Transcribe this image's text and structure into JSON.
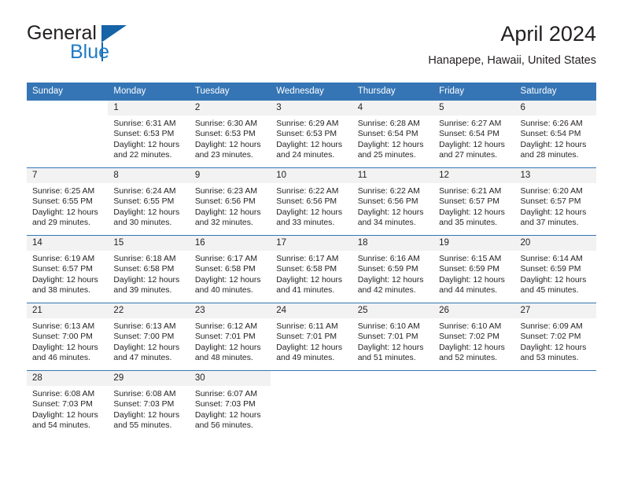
{
  "brand": {
    "name_part1": "General",
    "name_part2": "Blue",
    "logo_icon": "triangle-flag-icon"
  },
  "header": {
    "month_title": "April 2024",
    "location": "Hanapepe, Hawaii, United States"
  },
  "calendar": {
    "weekday_headers": [
      "Sunday",
      "Monday",
      "Tuesday",
      "Wednesday",
      "Thursday",
      "Friday",
      "Saturday"
    ],
    "accent_color": "#3575b5",
    "daynum_bg_color": "#f2f2f2",
    "labels": {
      "sunrise": "Sunrise:",
      "sunset": "Sunset:",
      "daylight": "Daylight:"
    },
    "weeks": [
      [
        {
          "day": "",
          "sunrise": "",
          "sunset": "",
          "daylight_line1": "",
          "daylight_line2": ""
        },
        {
          "day": "1",
          "sunrise": "Sunrise: 6:31 AM",
          "sunset": "Sunset: 6:53 PM",
          "daylight_line1": "Daylight: 12 hours",
          "daylight_line2": "and 22 minutes."
        },
        {
          "day": "2",
          "sunrise": "Sunrise: 6:30 AM",
          "sunset": "Sunset: 6:53 PM",
          "daylight_line1": "Daylight: 12 hours",
          "daylight_line2": "and 23 minutes."
        },
        {
          "day": "3",
          "sunrise": "Sunrise: 6:29 AM",
          "sunset": "Sunset: 6:53 PM",
          "daylight_line1": "Daylight: 12 hours",
          "daylight_line2": "and 24 minutes."
        },
        {
          "day": "4",
          "sunrise": "Sunrise: 6:28 AM",
          "sunset": "Sunset: 6:54 PM",
          "daylight_line1": "Daylight: 12 hours",
          "daylight_line2": "and 25 minutes."
        },
        {
          "day": "5",
          "sunrise": "Sunrise: 6:27 AM",
          "sunset": "Sunset: 6:54 PM",
          "daylight_line1": "Daylight: 12 hours",
          "daylight_line2": "and 27 minutes."
        },
        {
          "day": "6",
          "sunrise": "Sunrise: 6:26 AM",
          "sunset": "Sunset: 6:54 PM",
          "daylight_line1": "Daylight: 12 hours",
          "daylight_line2": "and 28 minutes."
        }
      ],
      [
        {
          "day": "7",
          "sunrise": "Sunrise: 6:25 AM",
          "sunset": "Sunset: 6:55 PM",
          "daylight_line1": "Daylight: 12 hours",
          "daylight_line2": "and 29 minutes."
        },
        {
          "day": "8",
          "sunrise": "Sunrise: 6:24 AM",
          "sunset": "Sunset: 6:55 PM",
          "daylight_line1": "Daylight: 12 hours",
          "daylight_line2": "and 30 minutes."
        },
        {
          "day": "9",
          "sunrise": "Sunrise: 6:23 AM",
          "sunset": "Sunset: 6:56 PM",
          "daylight_line1": "Daylight: 12 hours",
          "daylight_line2": "and 32 minutes."
        },
        {
          "day": "10",
          "sunrise": "Sunrise: 6:22 AM",
          "sunset": "Sunset: 6:56 PM",
          "daylight_line1": "Daylight: 12 hours",
          "daylight_line2": "and 33 minutes."
        },
        {
          "day": "11",
          "sunrise": "Sunrise: 6:22 AM",
          "sunset": "Sunset: 6:56 PM",
          "daylight_line1": "Daylight: 12 hours",
          "daylight_line2": "and 34 minutes."
        },
        {
          "day": "12",
          "sunrise": "Sunrise: 6:21 AM",
          "sunset": "Sunset: 6:57 PM",
          "daylight_line1": "Daylight: 12 hours",
          "daylight_line2": "and 35 minutes."
        },
        {
          "day": "13",
          "sunrise": "Sunrise: 6:20 AM",
          "sunset": "Sunset: 6:57 PM",
          "daylight_line1": "Daylight: 12 hours",
          "daylight_line2": "and 37 minutes."
        }
      ],
      [
        {
          "day": "14",
          "sunrise": "Sunrise: 6:19 AM",
          "sunset": "Sunset: 6:57 PM",
          "daylight_line1": "Daylight: 12 hours",
          "daylight_line2": "and 38 minutes."
        },
        {
          "day": "15",
          "sunrise": "Sunrise: 6:18 AM",
          "sunset": "Sunset: 6:58 PM",
          "daylight_line1": "Daylight: 12 hours",
          "daylight_line2": "and 39 minutes."
        },
        {
          "day": "16",
          "sunrise": "Sunrise: 6:17 AM",
          "sunset": "Sunset: 6:58 PM",
          "daylight_line1": "Daylight: 12 hours",
          "daylight_line2": "and 40 minutes."
        },
        {
          "day": "17",
          "sunrise": "Sunrise: 6:17 AM",
          "sunset": "Sunset: 6:58 PM",
          "daylight_line1": "Daylight: 12 hours",
          "daylight_line2": "and 41 minutes."
        },
        {
          "day": "18",
          "sunrise": "Sunrise: 6:16 AM",
          "sunset": "Sunset: 6:59 PM",
          "daylight_line1": "Daylight: 12 hours",
          "daylight_line2": "and 42 minutes."
        },
        {
          "day": "19",
          "sunrise": "Sunrise: 6:15 AM",
          "sunset": "Sunset: 6:59 PM",
          "daylight_line1": "Daylight: 12 hours",
          "daylight_line2": "and 44 minutes."
        },
        {
          "day": "20",
          "sunrise": "Sunrise: 6:14 AM",
          "sunset": "Sunset: 6:59 PM",
          "daylight_line1": "Daylight: 12 hours",
          "daylight_line2": "and 45 minutes."
        }
      ],
      [
        {
          "day": "21",
          "sunrise": "Sunrise: 6:13 AM",
          "sunset": "Sunset: 7:00 PM",
          "daylight_line1": "Daylight: 12 hours",
          "daylight_line2": "and 46 minutes."
        },
        {
          "day": "22",
          "sunrise": "Sunrise: 6:13 AM",
          "sunset": "Sunset: 7:00 PM",
          "daylight_line1": "Daylight: 12 hours",
          "daylight_line2": "and 47 minutes."
        },
        {
          "day": "23",
          "sunrise": "Sunrise: 6:12 AM",
          "sunset": "Sunset: 7:01 PM",
          "daylight_line1": "Daylight: 12 hours",
          "daylight_line2": "and 48 minutes."
        },
        {
          "day": "24",
          "sunrise": "Sunrise: 6:11 AM",
          "sunset": "Sunset: 7:01 PM",
          "daylight_line1": "Daylight: 12 hours",
          "daylight_line2": "and 49 minutes."
        },
        {
          "day": "25",
          "sunrise": "Sunrise: 6:10 AM",
          "sunset": "Sunset: 7:01 PM",
          "daylight_line1": "Daylight: 12 hours",
          "daylight_line2": "and 51 minutes."
        },
        {
          "day": "26",
          "sunrise": "Sunrise: 6:10 AM",
          "sunset": "Sunset: 7:02 PM",
          "daylight_line1": "Daylight: 12 hours",
          "daylight_line2": "and 52 minutes."
        },
        {
          "day": "27",
          "sunrise": "Sunrise: 6:09 AM",
          "sunset": "Sunset: 7:02 PM",
          "daylight_line1": "Daylight: 12 hours",
          "daylight_line2": "and 53 minutes."
        }
      ],
      [
        {
          "day": "28",
          "sunrise": "Sunrise: 6:08 AM",
          "sunset": "Sunset: 7:03 PM",
          "daylight_line1": "Daylight: 12 hours",
          "daylight_line2": "and 54 minutes."
        },
        {
          "day": "29",
          "sunrise": "Sunrise: 6:08 AM",
          "sunset": "Sunset: 7:03 PM",
          "daylight_line1": "Daylight: 12 hours",
          "daylight_line2": "and 55 minutes."
        },
        {
          "day": "30",
          "sunrise": "Sunrise: 6:07 AM",
          "sunset": "Sunset: 7:03 PM",
          "daylight_line1": "Daylight: 12 hours",
          "daylight_line2": "and 56 minutes."
        },
        {
          "day": "",
          "sunrise": "",
          "sunset": "",
          "daylight_line1": "",
          "daylight_line2": ""
        },
        {
          "day": "",
          "sunrise": "",
          "sunset": "",
          "daylight_line1": "",
          "daylight_line2": ""
        },
        {
          "day": "",
          "sunrise": "",
          "sunset": "",
          "daylight_line1": "",
          "daylight_line2": ""
        },
        {
          "day": "",
          "sunrise": "",
          "sunset": "",
          "daylight_line1": "",
          "daylight_line2": ""
        }
      ]
    ]
  }
}
